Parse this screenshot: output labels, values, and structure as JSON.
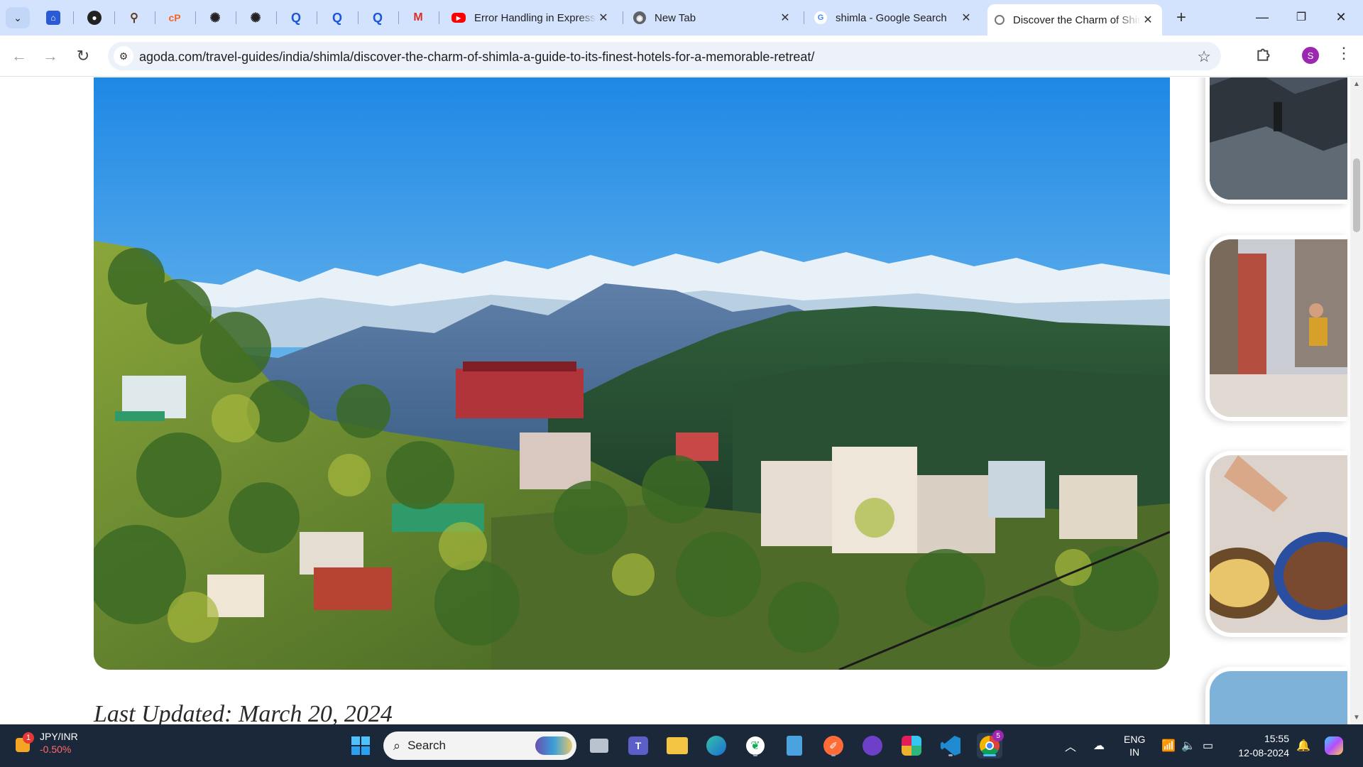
{
  "browser": {
    "tabs": [
      {
        "title": "Error Handling in Express",
        "favicon": "youtube-icon",
        "active": false
      },
      {
        "title": "New Tab",
        "favicon": "chrome-icon",
        "active": false
      },
      {
        "title": "shimla - Google Search",
        "favicon": "google-icon",
        "active": false
      },
      {
        "title": "Discover the Charm of Shimla",
        "favicon": "agoda-icon",
        "active": true
      }
    ],
    "pinned_tabs": [
      "swiggy-icon",
      "github-icon",
      "bird-icon",
      "cp-icon",
      "chatgpt-icon",
      "chatgpt-icon",
      "q-icon",
      "q-icon",
      "q-icon",
      "gmail-icon"
    ],
    "url": "agoda.com/travel-guides/india/shimla/discover-the-charm-of-shimla-a-guide-to-its-finest-hotels-for-a-memorable-retreat/",
    "profile_initial": "S"
  },
  "article": {
    "last_updated": "Last Updated: March 20, 2024"
  },
  "taskbar": {
    "widget": {
      "badge": "1",
      "symbol": "JPY/INR",
      "change": "-0.50%"
    },
    "search_placeholder": "Search",
    "chrome_badge": "5",
    "lang_top": "ENG",
    "lang_bottom": "IN",
    "time": "15:55",
    "date": "12-08-2024"
  },
  "colors": {
    "tab_strip": "#d3e3fd",
    "taskbar": "#1b2839",
    "sky_top": "#1e88e5",
    "profile": "#9c27b0"
  }
}
